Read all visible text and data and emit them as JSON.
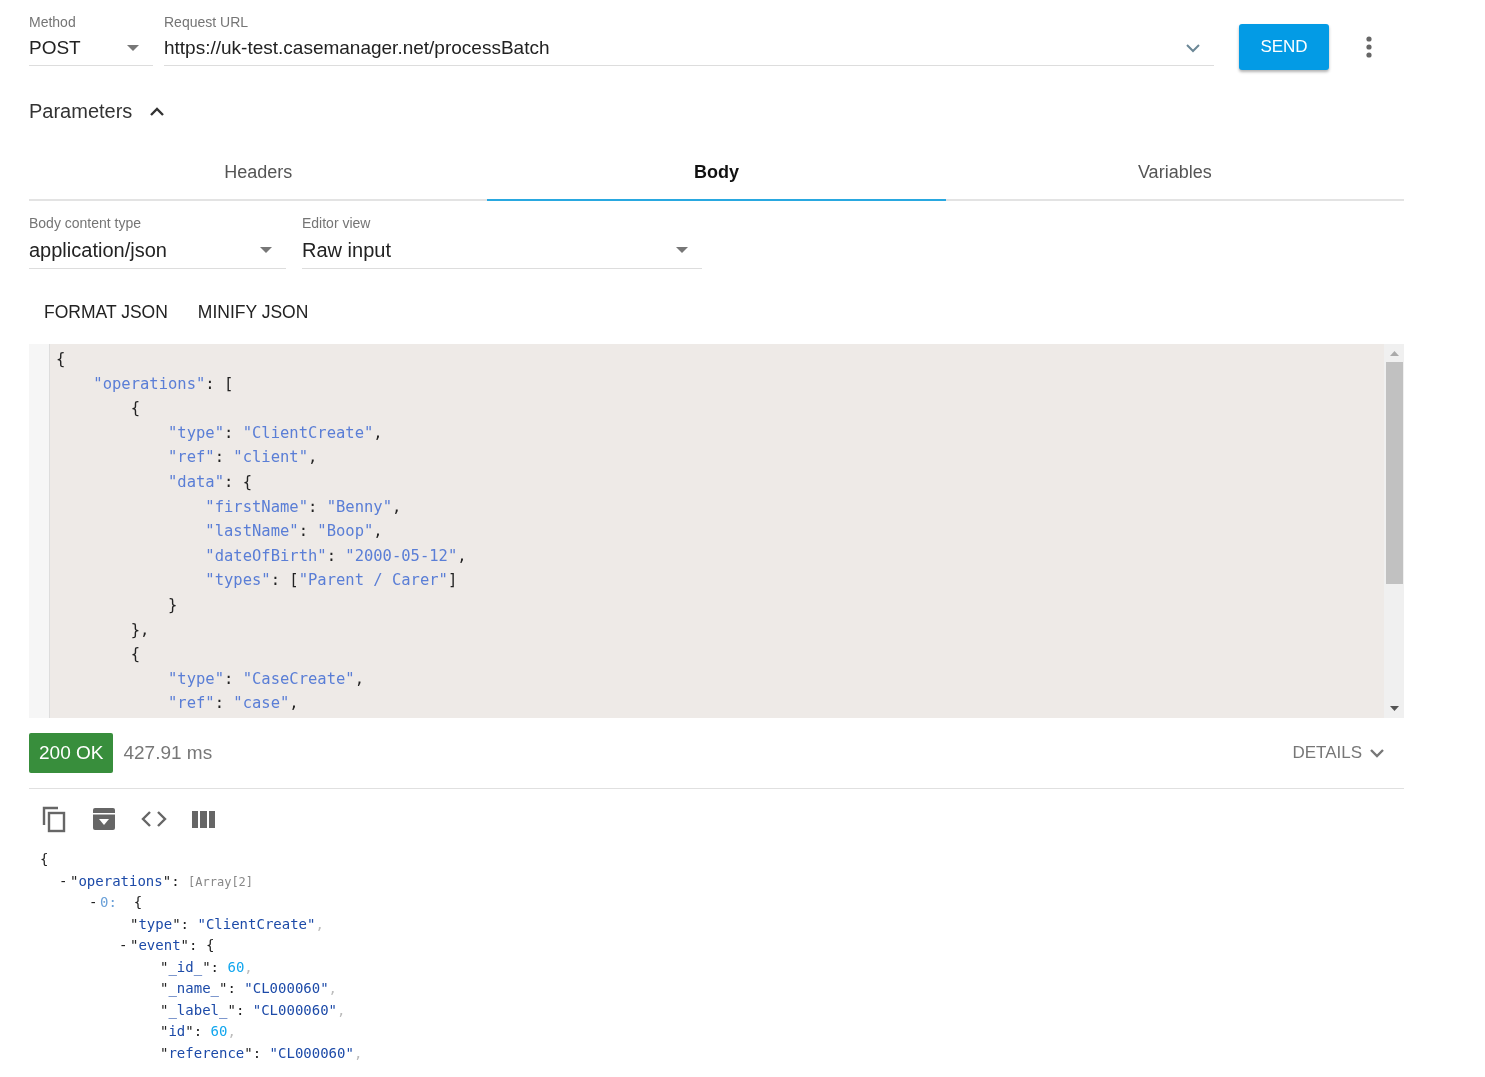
{
  "request": {
    "method": {
      "label": "Method",
      "value": "POST"
    },
    "url": {
      "label": "Request URL",
      "value": "https://uk-test.casemanager.net/processBatch"
    },
    "send_button": "SEND"
  },
  "parameters": {
    "title": "Parameters",
    "expanded": true
  },
  "tabs": [
    {
      "label": "Headers",
      "selected": false
    },
    {
      "label": "Body",
      "selected": true
    },
    {
      "label": "Variables",
      "selected": false
    }
  ],
  "body": {
    "content_type": {
      "label": "Body content type",
      "value": "application/json"
    },
    "editor_view": {
      "label": "Editor view",
      "value": "Raw input"
    },
    "actions": [
      "FORMAT JSON",
      "MINIFY JSON"
    ],
    "editor_lines": [
      [
        {
          "kind": "punct",
          "text": "{"
        }
      ],
      [
        {
          "kind": "key",
          "text": "    \"operations\""
        },
        {
          "kind": "punct",
          "text": ": ["
        }
      ],
      [
        {
          "kind": "punct",
          "text": "        {"
        }
      ],
      [
        {
          "kind": "key",
          "text": "            \"type\""
        },
        {
          "kind": "punct",
          "text": ": "
        },
        {
          "kind": "string",
          "text": "\"ClientCreate\""
        },
        {
          "kind": "punct",
          "text": ","
        }
      ],
      [
        {
          "kind": "key",
          "text": "            \"ref\""
        },
        {
          "kind": "punct",
          "text": ": "
        },
        {
          "kind": "string",
          "text": "\"client\""
        },
        {
          "kind": "punct",
          "text": ","
        }
      ],
      [
        {
          "kind": "key",
          "text": "            \"data\""
        },
        {
          "kind": "punct",
          "text": ": {"
        }
      ],
      [
        {
          "kind": "key",
          "text": "                \"firstName\""
        },
        {
          "kind": "punct",
          "text": ": "
        },
        {
          "kind": "string",
          "text": "\"Benny\""
        },
        {
          "kind": "punct",
          "text": ","
        }
      ],
      [
        {
          "kind": "key",
          "text": "                \"lastName\""
        },
        {
          "kind": "punct",
          "text": ": "
        },
        {
          "kind": "string",
          "text": "\"Boop\""
        },
        {
          "kind": "punct",
          "text": ","
        }
      ],
      [
        {
          "kind": "key",
          "text": "                \"dateOfBirth\""
        },
        {
          "kind": "punct",
          "text": ": "
        },
        {
          "kind": "string",
          "text": "\"2000-05-12\""
        },
        {
          "kind": "punct",
          "text": ","
        }
      ],
      [
        {
          "kind": "key",
          "text": "                \"types\""
        },
        {
          "kind": "punct",
          "text": ": ["
        },
        {
          "kind": "string",
          "text": "\"Parent / Carer\""
        },
        {
          "kind": "punct",
          "text": "]"
        }
      ],
      [
        {
          "kind": "punct",
          "text": "            }"
        }
      ],
      [
        {
          "kind": "punct",
          "text": "        },"
        }
      ],
      [
        {
          "kind": "punct",
          "text": "        {"
        }
      ],
      [
        {
          "kind": "key",
          "text": "            \"type\""
        },
        {
          "kind": "punct",
          "text": ": "
        },
        {
          "kind": "string",
          "text": "\"CaseCreate\""
        },
        {
          "kind": "punct",
          "text": ","
        }
      ],
      [
        {
          "kind": "key",
          "text": "            \"ref\""
        },
        {
          "kind": "punct",
          "text": ": "
        },
        {
          "kind": "string",
          "text": "\"case\""
        },
        {
          "kind": "punct",
          "text": ","
        }
      ]
    ]
  },
  "response": {
    "status": "200 OK",
    "time": "427.91 ms",
    "details": {
      "label": "DETAILS",
      "expanded": false
    },
    "tree": [
      {
        "tokens": [
          {
            "kind": "punct",
            "text": "{"
          }
        ],
        "children": [
          {
            "toggle": "-",
            "expanded": true,
            "tokens": [
              {
                "kind": "punct",
                "text": "\""
              },
              {
                "kind": "key",
                "text": "operations"
              },
              {
                "kind": "punct",
                "text": "\": "
              },
              {
                "kind": "meta",
                "text": "[Array[2]"
              }
            ],
            "children": [
              {
                "toggle": "-",
                "expanded": true,
                "tokens": [
                  {
                    "kind": "index",
                    "text": "0:"
                  },
                  {
                    "kind": "punct",
                    "text": "  {"
                  }
                ],
                "children": [
                  {
                    "tokens": [
                      {
                        "kind": "punct",
                        "text": "\""
                      },
                      {
                        "kind": "key",
                        "text": "type"
                      },
                      {
                        "kind": "punct",
                        "text": "\": "
                      },
                      {
                        "kind": "string",
                        "text": "\"ClientCreate\""
                      },
                      {
                        "kind": "comma",
                        "text": ","
                      }
                    ]
                  },
                  {
                    "toggle": "-",
                    "expanded": true,
                    "tokens": [
                      {
                        "kind": "punct",
                        "text": "\""
                      },
                      {
                        "kind": "key",
                        "text": "event"
                      },
                      {
                        "kind": "punct",
                        "text": "\": {"
                      }
                    ],
                    "children": [
                      {
                        "tokens": [
                          {
                            "kind": "punct",
                            "text": "\""
                          },
                          {
                            "kind": "key",
                            "text": "_id_"
                          },
                          {
                            "kind": "punct",
                            "text": "\": "
                          },
                          {
                            "kind": "number",
                            "text": "60"
                          },
                          {
                            "kind": "comma",
                            "text": ","
                          }
                        ]
                      },
                      {
                        "tokens": [
                          {
                            "kind": "punct",
                            "text": "\""
                          },
                          {
                            "kind": "key",
                            "text": "_name_"
                          },
                          {
                            "kind": "punct",
                            "text": "\": "
                          },
                          {
                            "kind": "string",
                            "text": "\"CL000060\""
                          },
                          {
                            "kind": "comma",
                            "text": ","
                          }
                        ]
                      },
                      {
                        "tokens": [
                          {
                            "kind": "punct",
                            "text": "\""
                          },
                          {
                            "kind": "key",
                            "text": "_label_"
                          },
                          {
                            "kind": "punct",
                            "text": "\": "
                          },
                          {
                            "kind": "string",
                            "text": "\"CL000060\""
                          },
                          {
                            "kind": "comma",
                            "text": ","
                          }
                        ]
                      },
                      {
                        "tokens": [
                          {
                            "kind": "punct",
                            "text": "\""
                          },
                          {
                            "kind": "key",
                            "text": "id"
                          },
                          {
                            "kind": "punct",
                            "text": "\": "
                          },
                          {
                            "kind": "number",
                            "text": "60"
                          },
                          {
                            "kind": "comma",
                            "text": ","
                          }
                        ]
                      },
                      {
                        "tokens": [
                          {
                            "kind": "punct",
                            "text": "\""
                          },
                          {
                            "kind": "key",
                            "text": "reference"
                          },
                          {
                            "kind": "punct",
                            "text": "\": "
                          },
                          {
                            "kind": "string",
                            "text": "\"CL000060\""
                          },
                          {
                            "kind": "comma",
                            "text": ","
                          }
                        ]
                      }
                    ]
                  }
                ]
              }
            ]
          }
        ]
      }
    ]
  }
}
